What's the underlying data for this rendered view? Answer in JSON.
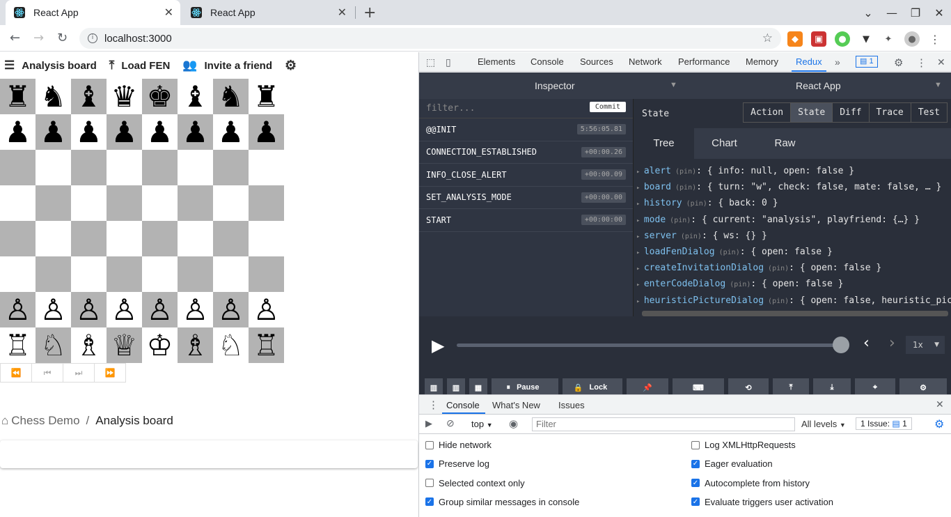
{
  "browser": {
    "tabs": [
      {
        "title": "React App",
        "active": true
      },
      {
        "title": "React App",
        "active": false
      }
    ],
    "new_tab_icon": "+",
    "address": "localhost:3000"
  },
  "app": {
    "toolbar": {
      "analysis_label": "Analysis board",
      "load_fen_label": "Load FEN",
      "invite_label": "Invite a friend"
    },
    "board": [
      [
        "♜",
        "♞",
        "♝",
        "♛",
        "♚",
        "♝",
        "♞",
        "♜"
      ],
      [
        "♟",
        "♟",
        "♟",
        "♟",
        "♟",
        "♟",
        "♟",
        "♟"
      ],
      [
        "",
        "",
        "",
        "",
        "",
        "",
        "",
        ""
      ],
      [
        "",
        "",
        "",
        "",
        "",
        "",
        "",
        ""
      ],
      [
        "",
        "",
        "",
        "",
        "",
        "",
        "",
        ""
      ],
      [
        "",
        "",
        "",
        "",
        "",
        "",
        "",
        ""
      ],
      [
        "♙",
        "♙",
        "♙",
        "♙",
        "♙",
        "♙",
        "♙",
        "♙"
      ],
      [
        "♖",
        "♘",
        "♗",
        "♕",
        "♔",
        "♗",
        "♘",
        "♖"
      ]
    ],
    "history_nav": [
      "⏪",
      "⏮",
      "⏭",
      "⏩"
    ],
    "breadcrumb": {
      "root": "Chess Demo",
      "separator": "/",
      "current": "Analysis board"
    }
  },
  "devtools": {
    "tabs": [
      "Elements",
      "Console",
      "Sources",
      "Network",
      "Performance",
      "Memory",
      "Redux"
    ],
    "selected_tab": "Redux",
    "issues_badge": "1",
    "redux": {
      "inspector_label": "Inspector",
      "instance_label": "React App",
      "filter_placeholder": "filter...",
      "commit_label": "Commit",
      "actions": [
        {
          "name": "@@INIT",
          "time": "5:56:05.81"
        },
        {
          "name": "CONNECTION_ESTABLISHED",
          "time": "+00:00.26"
        },
        {
          "name": "INFO_CLOSE_ALERT",
          "time": "+00:00.09"
        },
        {
          "name": "SET_ANALYSIS_MODE",
          "time": "+00:00.00"
        },
        {
          "name": "START",
          "time": "+00:00:00"
        }
      ],
      "panel_title": "State",
      "panel_buttons": [
        "Action",
        "State",
        "Diff",
        "Trace",
        "Test"
      ],
      "active_panel_button": "State",
      "view_tabs": [
        "Tree",
        "Chart",
        "Raw"
      ],
      "active_view_tab": "Tree",
      "pin_label": "(pin)",
      "tree": [
        {
          "key": "alert",
          "value": "{ info: null, open: false }"
        },
        {
          "key": "board",
          "value": "{ turn: \"w\", check: false, mate: false, … }"
        },
        {
          "key": "history",
          "value": "{ back: 0 }"
        },
        {
          "key": "mode",
          "value": "{ current: \"analysis\", playfriend: {…} }"
        },
        {
          "key": "server",
          "value": "{ ws: {} }"
        },
        {
          "key": "loadFenDialog",
          "value": "{ open: false }"
        },
        {
          "key": "createInvitationDialog",
          "value": "{ open: false }"
        },
        {
          "key": "enterCodeDialog",
          "value": "{ open: false }"
        },
        {
          "key": "heuristicPictureDialog",
          "value": "{ open: false, heuristic_pictu"
        }
      ],
      "speed": "1x",
      "slider_position": 1.0,
      "footer_buttons": {
        "pause": "Pause",
        "lock": "Lock"
      }
    },
    "console_drawer": {
      "tabs": [
        "Console",
        "What's New",
        "Issues"
      ],
      "context": "top",
      "filter_placeholder": "Filter",
      "levels": "All levels",
      "issues_label": "1 Issue:",
      "issues_count": "1",
      "settings_left": [
        {
          "label": "Hide network",
          "checked": false
        },
        {
          "label": "Preserve log",
          "checked": true
        },
        {
          "label": "Selected context only",
          "checked": false
        },
        {
          "label": "Group similar messages in console",
          "checked": true
        }
      ],
      "settings_right": [
        {
          "label": "Log XMLHttpRequests",
          "checked": false
        },
        {
          "label": "Eager evaluation",
          "checked": true
        },
        {
          "label": "Autocomplete from history",
          "checked": true
        },
        {
          "label": "Evaluate triggers user activation",
          "checked": true
        }
      ]
    }
  }
}
